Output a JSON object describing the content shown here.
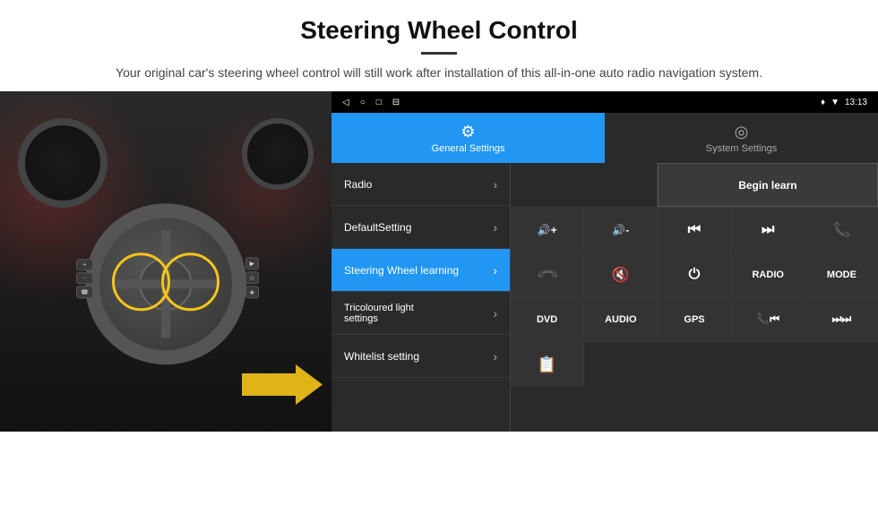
{
  "header": {
    "title": "Steering Wheel Control",
    "subtitle": "Your original car's steering wheel control will still work after installation of this all-in-one auto radio navigation system."
  },
  "statusbar": {
    "time": "13:13",
    "nav_icons": [
      "◁",
      "○",
      "□",
      "⊟"
    ],
    "right_icons": [
      "♦",
      "▼"
    ]
  },
  "tabs": [
    {
      "id": "general",
      "label": "General Settings",
      "icon": "⚙",
      "active": true
    },
    {
      "id": "system",
      "label": "System Settings",
      "icon": "◎",
      "active": false
    }
  ],
  "menu_items": [
    {
      "id": "radio",
      "label": "Radio",
      "active": false
    },
    {
      "id": "default",
      "label": "DefaultSetting",
      "active": false
    },
    {
      "id": "steering",
      "label": "Steering Wheel learning",
      "active": true
    },
    {
      "id": "tricolour",
      "label": "Tricoloured light settings",
      "active": false
    },
    {
      "id": "whitelist",
      "label": "Whitelist setting",
      "active": false
    }
  ],
  "control_panel": {
    "begin_learn_label": "Begin learn",
    "row1": {
      "empty": true,
      "btn": "Begin learn"
    },
    "row2": {
      "btns": [
        "🔊+",
        "🔊-",
        "⏮",
        "⏭",
        "📞"
      ]
    },
    "row3": {
      "btns": [
        "📞",
        "🔇",
        "⏻",
        "RADIO",
        "MODE"
      ]
    },
    "row4": {
      "btns": [
        "DVD",
        "AUDIO",
        "GPS",
        "📞⏮",
        "⏭⏭"
      ]
    },
    "row5": {
      "btns": [
        "📋"
      ]
    }
  },
  "icons": {
    "vol_up": "◀+",
    "vol_down": "◀-",
    "prev_track": "⏮",
    "next_track": "⏭",
    "phone": "📞",
    "hang_up": "📞",
    "mute": "🔇",
    "power": "⏻",
    "radio_label": "RADIO",
    "mode_label": "MODE",
    "dvd_label": "DVD",
    "audio_label": "AUDIO",
    "gps_label": "GPS",
    "list_icon": "≡"
  }
}
